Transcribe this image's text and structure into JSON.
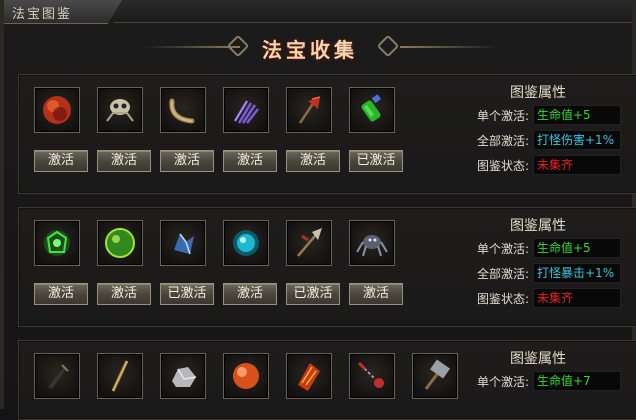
{
  "window": {
    "tab_title": "法宝图鉴"
  },
  "header": {
    "title": "法宝收集"
  },
  "groups": [
    {
      "items": [
        {
          "icon": "red-orb-icon",
          "button": "激活"
        },
        {
          "icon": "skull-beast-icon",
          "button": "激活"
        },
        {
          "icon": "curved-horn-icon",
          "button": "激活"
        },
        {
          "icon": "purple-claw-icon",
          "button": "激活"
        },
        {
          "icon": "red-axe-icon",
          "button": "激活"
        },
        {
          "icon": "green-potion-icon",
          "button": "已激活"
        }
      ],
      "attr_title": "图鉴属性",
      "single_label": "单个激活:",
      "single_value": "生命值+5",
      "all_label": "全部激活:",
      "all_value": "打怪伤害+1%",
      "status_label": "图鉴状态:",
      "status_value": "未集齐",
      "colors": {
        "single": "#2fdc2f",
        "all": "#31c8e0",
        "status": "#e82020"
      }
    },
    {
      "items": [
        {
          "icon": "green-rune-icon",
          "button": "激活"
        },
        {
          "icon": "green-orb-icon",
          "button": "激活"
        },
        {
          "icon": "blue-crystal-icon",
          "button": "已激活"
        },
        {
          "icon": "cyan-orb-icon",
          "button": "激活"
        },
        {
          "icon": "halberd-icon",
          "button": "已激活"
        },
        {
          "icon": "spider-claw-icon",
          "button": "激活"
        }
      ],
      "attr_title": "图鉴属性",
      "single_label": "单个激活:",
      "single_value": "生命值+5",
      "all_label": "全部激活:",
      "all_value": "打怪暴击+1%",
      "status_label": "图鉴状态:",
      "status_value": "未集齐"
    },
    {
      "items": [
        {
          "icon": "dark-dagger-icon"
        },
        {
          "icon": "wooden-staff-icon"
        },
        {
          "icon": "silver-ore-icon"
        },
        {
          "icon": "orange-orb-icon"
        },
        {
          "icon": "fire-scale-icon"
        },
        {
          "icon": "chain-flail-icon"
        },
        {
          "icon": "hammer-icon"
        }
      ],
      "attr_title": "图鉴属性",
      "single_label": "单个激活:",
      "single_value": "生命值+7"
    }
  ]
}
